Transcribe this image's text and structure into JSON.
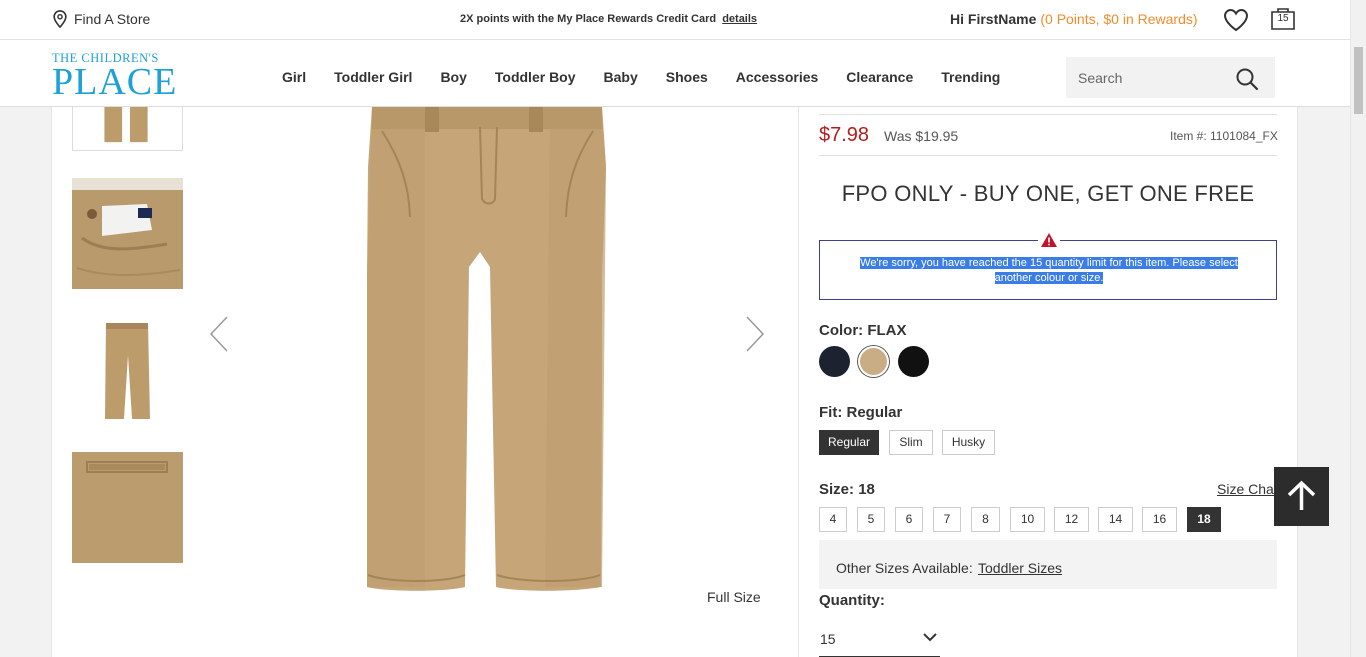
{
  "topbar": {
    "find_store": "Find A Store",
    "promo_text": "2X points with the My Place Rewards Credit Card",
    "promo_link": "details",
    "greeting": "Hi FirstName",
    "rewards": "(0 Points, $0 in Rewards)",
    "bag_count": "15"
  },
  "logo": {
    "line1": "THE CHILDREN'S",
    "line2": "PLACE"
  },
  "nav": [
    "Girl",
    "Toddler Girl",
    "Boy",
    "Toddler Boy",
    "Baby",
    "Shoes",
    "Accessories",
    "Clearance",
    "Trending"
  ],
  "search": {
    "placeholder": "Search"
  },
  "gallery": {
    "full_size": "Full Size"
  },
  "product": {
    "price": "$7.98",
    "was_price": "Was $19.95",
    "item_number": "Item #: 1101084_FX",
    "promo_title": "FPO ONLY - BUY ONE, GET ONE FREE",
    "alert": "We're sorry, you have reached the 15 quantity limit for this item. Please select another colour or size.",
    "color_label": "Color:",
    "color_value": "FLAX",
    "fit_label": "Fit:",
    "fit_value": "Regular",
    "fits": [
      "Regular",
      "Slim",
      "Husky"
    ],
    "size_label": "Size:",
    "size_value": "18",
    "size_chart": "Size Chart",
    "sizes": [
      "4",
      "5",
      "6",
      "7",
      "8",
      "10",
      "12",
      "14",
      "16",
      "18"
    ],
    "other_sizes_label": "Other Sizes Available:",
    "other_sizes_link": "Toddler Sizes",
    "quantity_label": "Quantity:",
    "quantity_value": "15",
    "swatches": [
      "#1c2230",
      "#c9ad84",
      "#111111"
    ]
  }
}
